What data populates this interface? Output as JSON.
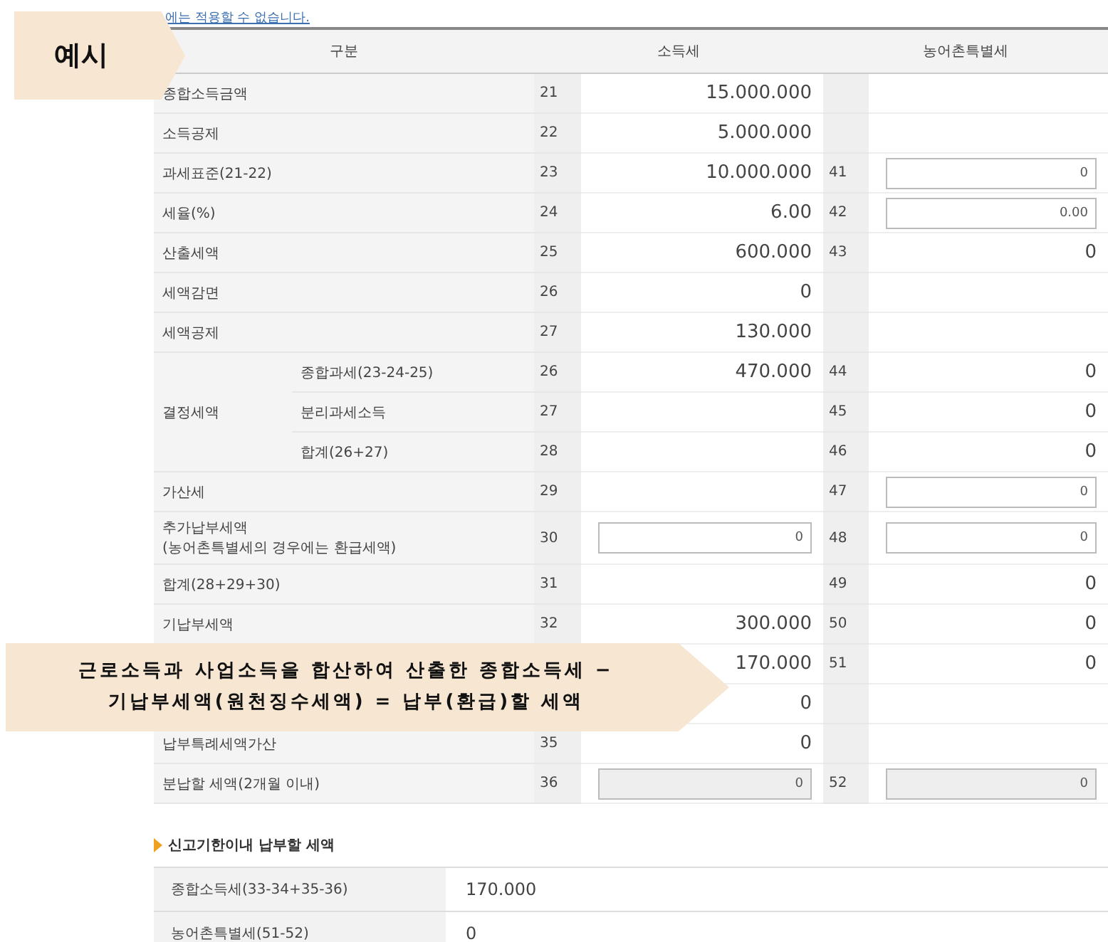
{
  "notice_link": "에는 적용할 수 없습니다.",
  "example_tag": "예시",
  "table": {
    "columns": [
      "구분",
      "소득세",
      "농어촌특별세"
    ],
    "rows": [
      {
        "label": "종합소득금액",
        "code": "21",
        "income": {
          "kind": "text",
          "value": "15.000.000"
        }
      },
      {
        "label": "소득공제",
        "code": "22",
        "income": {
          "kind": "text",
          "value": "5.000.000"
        }
      },
      {
        "label": "과세표준(21-22)",
        "code": "23",
        "income": {
          "kind": "text",
          "value": "10.000.000"
        },
        "rural_code": "41",
        "rural": {
          "kind": "input",
          "value": "0"
        }
      },
      {
        "label": "세율(%)",
        "code": "24",
        "income": {
          "kind": "text",
          "value": "6.00"
        },
        "rural_code": "42",
        "rural": {
          "kind": "input",
          "value": "0.00"
        }
      },
      {
        "label": "산출세액",
        "code": "25",
        "income": {
          "kind": "text",
          "value": "600.000"
        },
        "rural_code": "43",
        "rural": {
          "kind": "text",
          "value": "0"
        }
      },
      {
        "label": "세액감면",
        "code": "26",
        "income": {
          "kind": "text",
          "value": "0"
        }
      },
      {
        "label": "세액공제",
        "code": "27",
        "income": {
          "kind": "text",
          "value": "130.000"
        }
      },
      {
        "label": "결정세액",
        "children": [
          {
            "label": "종합과세(23-24-25)",
            "code": "26",
            "income": {
              "kind": "text",
              "value": "470.000"
            },
            "rural_code": "44",
            "rural": {
              "kind": "text",
              "value": "0"
            }
          },
          {
            "label": "분리과세소득",
            "code": "27",
            "rural_code": "45",
            "rural": {
              "kind": "text",
              "value": "0"
            }
          },
          {
            "label": "합계(26+27)",
            "code": "28",
            "rural_code": "46",
            "rural": {
              "kind": "text",
              "value": "0"
            }
          }
        ]
      },
      {
        "label": "가산세",
        "code": "29",
        "rural_code": "47",
        "rural": {
          "kind": "input",
          "value": "0"
        }
      },
      {
        "label": "추가납부세액\n(농어촌특별세의 경우에는 환급세액)",
        "code": "30",
        "income": {
          "kind": "input",
          "value": "0"
        },
        "rural_code": "48",
        "rural": {
          "kind": "input",
          "value": "0"
        }
      },
      {
        "label": "합계(28+29+30)",
        "code": "31",
        "rural_code": "49",
        "rural": {
          "kind": "text",
          "value": "0"
        }
      },
      {
        "label": "기납부세액",
        "code": "32",
        "income": {
          "kind": "text",
          "value": "300.000"
        },
        "rural_code": "50",
        "rural": {
          "kind": "text",
          "value": "0"
        }
      },
      {
        "income": {
          "kind": "text",
          "value": "170.000"
        },
        "rural_code": "51",
        "rural": {
          "kind": "text",
          "value": "0"
        }
      },
      {
        "income": {
          "kind": "text",
          "value": "0"
        }
      },
      {
        "label": "납부특례세액가산",
        "code": "35",
        "income": {
          "kind": "text",
          "value": "0"
        }
      },
      {
        "label": "분납할 세액(2개월 이내)",
        "code": "36",
        "income": {
          "kind": "disabled",
          "value": "0"
        },
        "rural_code": "52",
        "rural": {
          "kind": "disabled",
          "value": "0"
        }
      }
    ]
  },
  "callout": [
    "근로소득과 사업소득을 합산하여 산출한 종합소득세 −",
    "기납부세액(원천징수세액) = 납부(환급)할 세액"
  ],
  "due_section": {
    "title": "신고기한이내 납부할 세액",
    "rows": [
      {
        "label": "종합소득세(33-34+35-36)",
        "value": "170.000"
      },
      {
        "label": "농어촌특별세(51-52)",
        "value": "0"
      }
    ]
  }
}
